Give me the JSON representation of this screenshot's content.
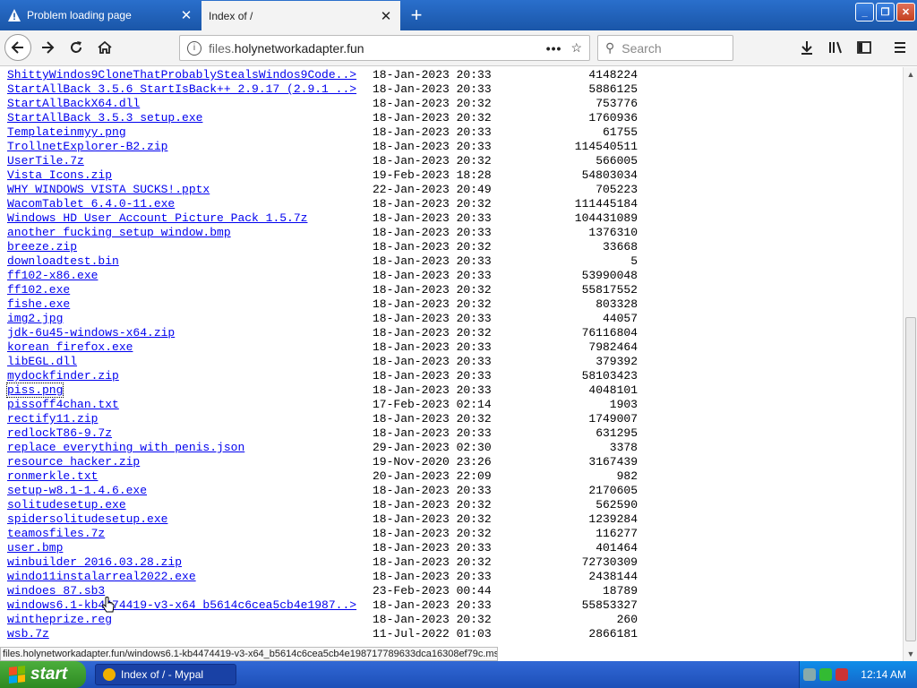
{
  "tabs": [
    {
      "label": "Problem loading page",
      "icon": "warning-icon",
      "active": false
    },
    {
      "label": "Index of /",
      "active": true
    }
  ],
  "url": {
    "host_dim": "files.",
    "host_main": "holynetworkadapter.fun"
  },
  "search_placeholder": "Search",
  "files": [
    {
      "name": "ShittyWindos9CloneThatProbablyStealsWindos9Code..>",
      "date": "18-Jan-2023 20:33",
      "size": "4148224"
    },
    {
      "name": "StartAllBack 3.5.6 StartIsBack++ 2.9.17 (2.9.1 ..>",
      "date": "18-Jan-2023 20:33",
      "size": "5886125"
    },
    {
      "name": "StartAllBackX64.dll",
      "date": "18-Jan-2023 20:32",
      "size": "753776"
    },
    {
      "name": "StartAllBack_3.5.3_setup.exe",
      "date": "18-Jan-2023 20:32",
      "size": "1760936"
    },
    {
      "name": "Templateinmyy.png",
      "date": "18-Jan-2023 20:33",
      "size": "61755"
    },
    {
      "name": "TrollnetExplorer-B2.zip",
      "date": "18-Jan-2023 20:33",
      "size": "114540511"
    },
    {
      "name": "UserTile.7z",
      "date": "18-Jan-2023 20:32",
      "size": "566005"
    },
    {
      "name": "Vista Icons.zip",
      "date": "19-Feb-2023 18:28",
      "size": "54803034"
    },
    {
      "name": "WHY WINDOWS VISTA SUCKS!.pptx",
      "date": "22-Jan-2023 20:49",
      "size": "705223"
    },
    {
      "name": "WacomTablet_6.4.0-11.exe",
      "date": "18-Jan-2023 20:32",
      "size": "111445184"
    },
    {
      "name": "Windows HD User Account Picture Pack 1.5.7z",
      "date": "18-Jan-2023 20:33",
      "size": "104431089"
    },
    {
      "name": "another fucking setup window.bmp",
      "date": "18-Jan-2023 20:33",
      "size": "1376310"
    },
    {
      "name": "breeze.zip",
      "date": "18-Jan-2023 20:32",
      "size": "33668"
    },
    {
      "name": "downloadtest.bin",
      "date": "18-Jan-2023 20:33",
      "size": "5"
    },
    {
      "name": "ff102-x86.exe",
      "date": "18-Jan-2023 20:33",
      "size": "53990048"
    },
    {
      "name": "ff102.exe",
      "date": "18-Jan-2023 20:32",
      "size": "55817552"
    },
    {
      "name": "fishe.exe",
      "date": "18-Jan-2023 20:32",
      "size": "803328"
    },
    {
      "name": "img2.jpg",
      "date": "18-Jan-2023 20:33",
      "size": "44057"
    },
    {
      "name": "jdk-6u45-windows-x64.zip",
      "date": "18-Jan-2023 20:32",
      "size": "76116804"
    },
    {
      "name": "korean firefox.exe",
      "date": "18-Jan-2023 20:33",
      "size": "7982464"
    },
    {
      "name": "libEGL.dll",
      "date": "18-Jan-2023 20:33",
      "size": "379392"
    },
    {
      "name": "mydockfinder.zip",
      "date": "18-Jan-2023 20:33",
      "size": "58103423"
    },
    {
      "name": "piss.png",
      "date": "18-Jan-2023 20:33",
      "size": "4048101",
      "focused": true
    },
    {
      "name": "pissoff4chan.txt",
      "date": "17-Feb-2023 02:14",
      "size": "1903"
    },
    {
      "name": "rectify11.zip",
      "date": "18-Jan-2023 20:32",
      "size": "1749007"
    },
    {
      "name": "redlockT86-9.7z",
      "date": "18-Jan-2023 20:33",
      "size": "631295"
    },
    {
      "name": "replace everything with penis.json",
      "date": "29-Jan-2023 02:30",
      "size": "3378"
    },
    {
      "name": "resource hacker.zip",
      "date": "19-Nov-2020 23:26",
      "size": "3167439"
    },
    {
      "name": "ronmerkle.txt",
      "date": "20-Jan-2023 22:09",
      "size": "982"
    },
    {
      "name": "setup-w8.1-1.4.6.exe",
      "date": "18-Jan-2023 20:33",
      "size": "2170605"
    },
    {
      "name": "solitudesetup.exe",
      "date": "18-Jan-2023 20:32",
      "size": "562590"
    },
    {
      "name": "spidersolitudesetup.exe",
      "date": "18-Jan-2023 20:32",
      "size": "1239284"
    },
    {
      "name": "teamosfiles.7z",
      "date": "18-Jan-2023 20:32",
      "size": "116277"
    },
    {
      "name": "user.bmp",
      "date": "18-Jan-2023 20:33",
      "size": "401464"
    },
    {
      "name": "winbuilder 2016.03.28.zip",
      "date": "18-Jan-2023 20:32",
      "size": "72730309"
    },
    {
      "name": "windo11instalarreal2022.exe",
      "date": "18-Jan-2023 20:33",
      "size": "2438144"
    },
    {
      "name": "windoes 87.sb3",
      "date": "23-Feb-2023 00:44",
      "size": "18789"
    },
    {
      "name": "windows6.1-kb4474419-v3-x64_b5614c6cea5cb4e1987..>",
      "date": "18-Jan-2023 20:33",
      "size": "55853327"
    },
    {
      "name": "wintheprize.reg",
      "date": "18-Jan-2023 20:32",
      "size": "260"
    },
    {
      "name": "wsb.7z",
      "date": "11-Jul-2022 01:03",
      "size": "2866181"
    }
  ],
  "status_url": "files.holynetworkadapter.fun/windows6.1-kb4474419-v3-x64_b5614c6cea5cb4e198717789633dca16308ef79c.msu",
  "taskbar": {
    "start_label": "start",
    "task_label": "Index of / - Mypal",
    "clock": "12:14 AM"
  },
  "colors": {
    "link": "#0000ee",
    "titlebar": "#1a56a8",
    "taskbar": "#245edb",
    "start": "#3c9b2e"
  }
}
